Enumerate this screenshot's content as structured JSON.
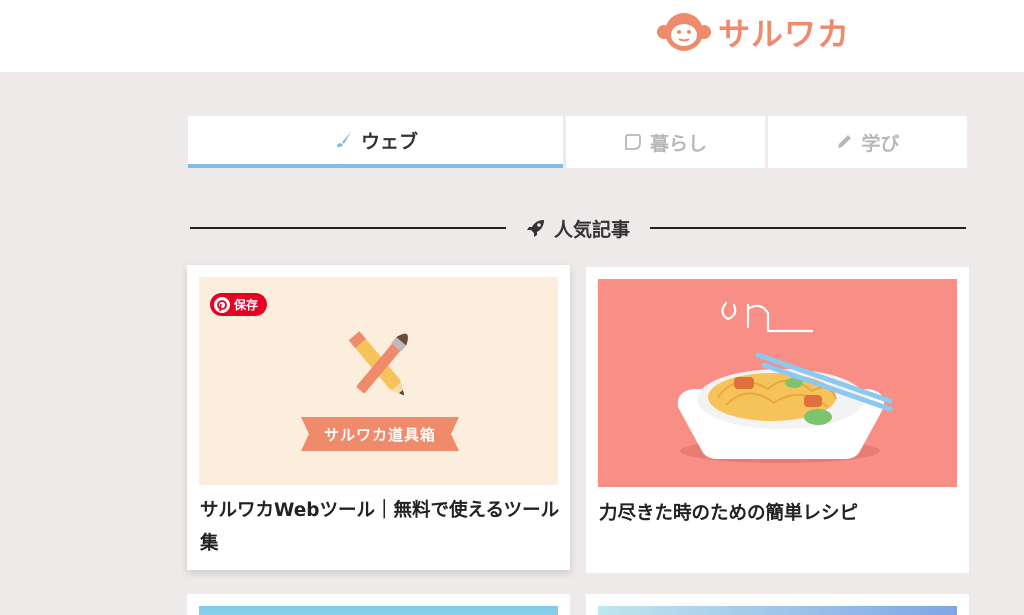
{
  "header": {
    "logo_text": "サルワカ"
  },
  "tabs": [
    {
      "label": "ウェブ",
      "icon": "brush-icon",
      "active": true
    },
    {
      "label": "暮らし",
      "icon": "leaf-icon",
      "active": false
    },
    {
      "label": "学び",
      "icon": "pencil-icon",
      "active": false
    }
  ],
  "section": {
    "title": "人気記事",
    "icon": "rocket-icon"
  },
  "articles": [
    {
      "title": "サルワカWebツール｜無料で使えるツール集",
      "thumb_banner": "サルワカ道具箱",
      "save_label": "保存"
    },
    {
      "title": "力尽きた時のための簡単レシピ"
    }
  ],
  "colors": {
    "brand": "#ef8a6a",
    "tab_active": "#7fbde8",
    "background": "#eeeae9",
    "pinterest": "#e60023"
  }
}
